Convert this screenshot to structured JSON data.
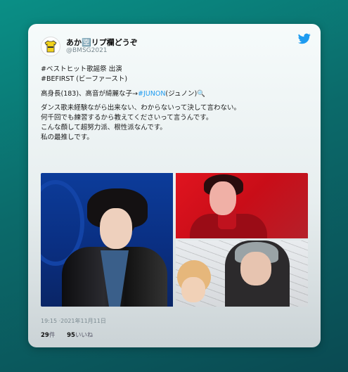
{
  "user": {
    "display_name": "あか🈳リプ欄どうぞ",
    "handle": "@BMSG2021"
  },
  "tweet": {
    "lines": [
      "#ベストヒット歌謡祭 出演",
      "#BEFIRST (ビーファースト)",
      "高身長(183)、高音が綺麗な子→",
      "#JUNON",
      "(ジュノン)🔍",
      "ダンス歌未経験ながら出来ない、わからないって決して言わない。",
      "何千回でも練習するから教えてくださいって言うんです。",
      "こんな顔して超努力派、根性派なんです。",
      "私の最推しです。"
    ],
    "timestamp": "19:15 ·2021年11月11日",
    "retweets_count": "29",
    "retweets_label": "件",
    "likes_count": "95",
    "likes_label": "いいね"
  },
  "icons": {
    "brand": "twitter-bird-icon",
    "avatar": "yellow-shirt-avatar"
  },
  "colors": {
    "accent": "#1d9bf0",
    "background": "#0a7a76"
  }
}
